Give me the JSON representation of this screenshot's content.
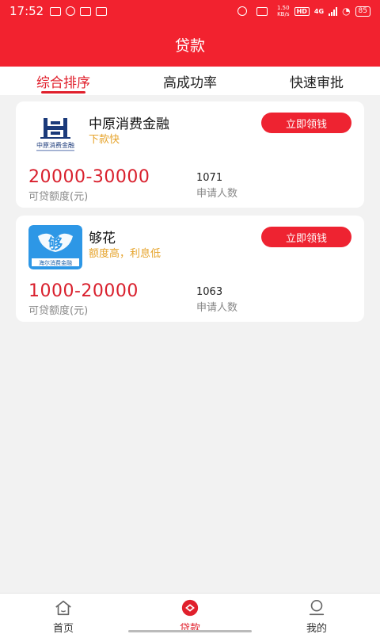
{
  "status_bar": {
    "time": "17:52",
    "net_speed": "1.50\nKB/s",
    "hd": "HD",
    "network": "4G",
    "battery": "85"
  },
  "header": {
    "title": "贷款"
  },
  "tabs": [
    {
      "label": "综合排序",
      "active": true
    },
    {
      "label": "高成功率",
      "active": false
    },
    {
      "label": "快速审批",
      "active": false
    }
  ],
  "products": [
    {
      "name": "中原消费金融",
      "tag": "下款快",
      "button": "立即领钱",
      "amount": "20000-30000",
      "amount_label": "可贷额度(元)",
      "count": "1071",
      "count_label": "申请人数",
      "logo_text": "中原消费金融"
    },
    {
      "name": "够花",
      "tag": "额度高，利息低",
      "button": "立即领钱",
      "amount": "1000-20000",
      "amount_label": "可贷额度(元)",
      "count": "1063",
      "count_label": "申请人数",
      "logo_text": "海尔消费金融"
    }
  ],
  "bottom_nav": [
    {
      "label": "首页",
      "icon": "home-icon",
      "active": false
    },
    {
      "label": "贷款",
      "icon": "loan-icon",
      "active": true
    },
    {
      "label": "我的",
      "icon": "profile-icon",
      "active": false
    }
  ],
  "colors": {
    "brand": "#f2222f",
    "accent": "#e0202c",
    "tag": "#e6a32a"
  }
}
